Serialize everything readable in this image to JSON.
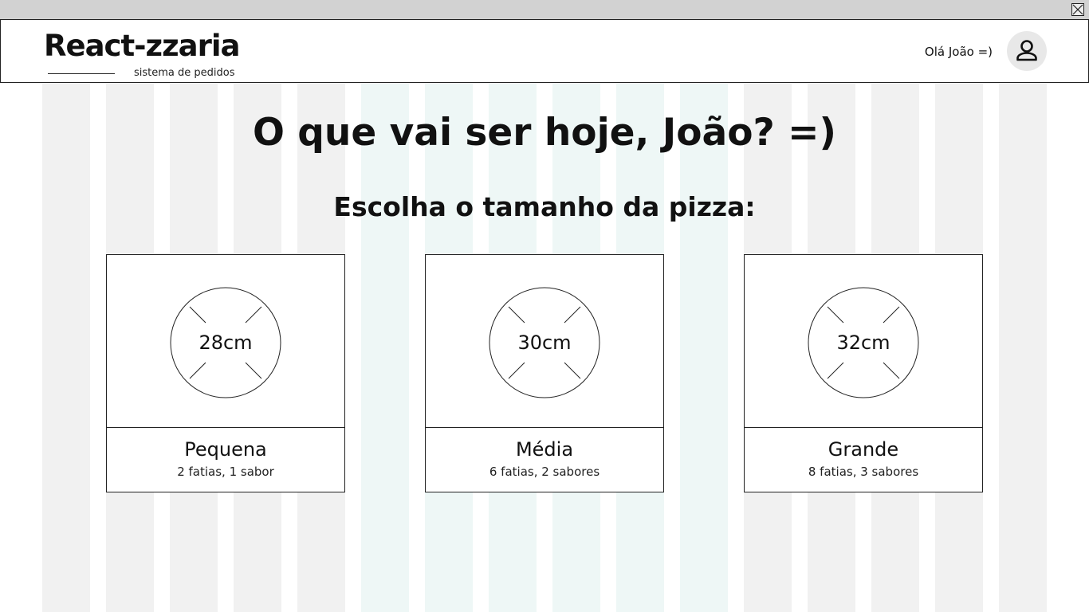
{
  "app": {
    "logo_title": "React-zzaria",
    "logo_subtitle": "sistema de pedidos"
  },
  "header": {
    "greeting": "Olá João =)",
    "avatar_icon": "user-icon"
  },
  "window": {
    "close_icon": "close-icon"
  },
  "main": {
    "title": "O que vai ser hoje, João? =)",
    "subtitle": "Escolha o tamanho da pizza:"
  },
  "sizes": [
    {
      "size": "28cm",
      "name": "Pequena",
      "description": "2 fatias, 1 sabor"
    },
    {
      "size": "30cm",
      "name": "Média",
      "description": "6 fatias, 2 sabores"
    },
    {
      "size": "32cm",
      "name": "Grande",
      "description": "8 fatias, 3 sabores"
    }
  ],
  "colors": {
    "grid_gray": "#f1f1f1",
    "grid_teal": "#eef7f6",
    "border": "#222222",
    "avatar_bg": "#e8e8e8"
  }
}
